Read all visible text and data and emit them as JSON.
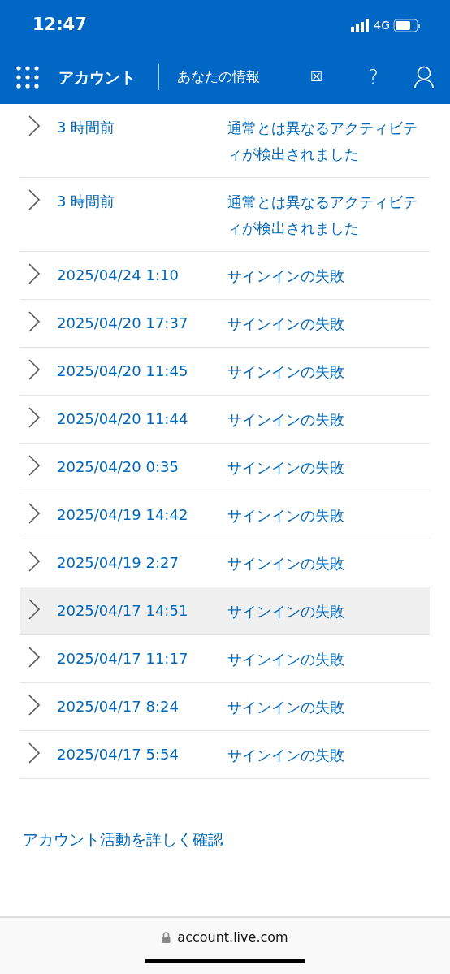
{
  "status_bar": {
    "time": "12:47",
    "network": "4G"
  },
  "nav": {
    "title": "アカウント",
    "section": "あなたの情報",
    "glyph": "☒",
    "help": "?"
  },
  "activity": [
    {
      "time": "3 時間前",
      "event": "通常とは異なるアクティビティが検出されました",
      "selected": false
    },
    {
      "time": "3 時間前",
      "event": "通常とは異なるアクティビティが検出されました",
      "selected": false
    },
    {
      "time": "2025/04/24 1:10",
      "event": "サインインの失敗",
      "selected": false
    },
    {
      "time": "2025/04/20 17:37",
      "event": "サインインの失敗",
      "selected": false
    },
    {
      "time": "2025/04/20 11:45",
      "event": "サインインの失敗",
      "selected": false
    },
    {
      "time": "2025/04/20 11:44",
      "event": "サインインの失敗",
      "selected": false
    },
    {
      "time": "2025/04/20 0:35",
      "event": "サインインの失敗",
      "selected": false
    },
    {
      "time": "2025/04/19 14:42",
      "event": "サインインの失敗",
      "selected": false
    },
    {
      "time": "2025/04/19 2:27",
      "event": "サインインの失敗",
      "selected": false
    },
    {
      "time": "2025/04/17 14:51",
      "event": "サインインの失敗",
      "selected": true
    },
    {
      "time": "2025/04/17 11:17",
      "event": "サインインの失敗",
      "selected": false
    },
    {
      "time": "2025/04/17 8:24",
      "event": "サインインの失敗",
      "selected": false
    },
    {
      "time": "2025/04/17 5:54",
      "event": "サインインの失敗",
      "selected": false
    }
  ],
  "review_link": "アカウント活動を詳しく確認",
  "address_bar": {
    "url": "account.live.com"
  }
}
